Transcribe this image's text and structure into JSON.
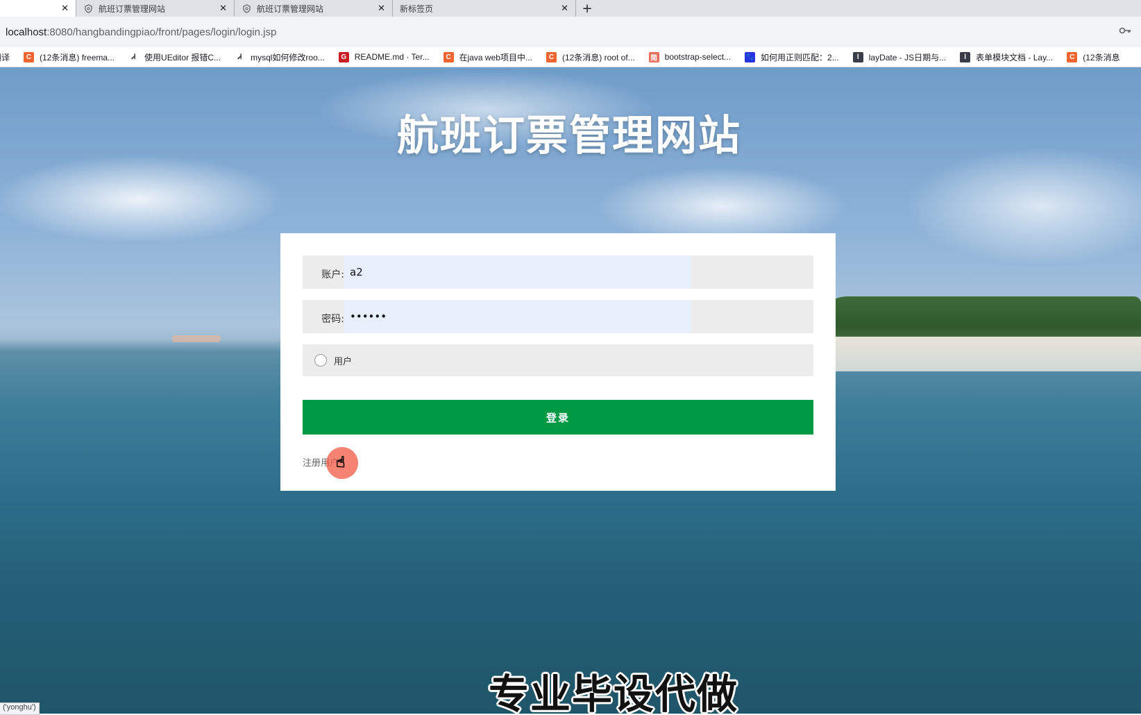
{
  "browser": {
    "tabs": [
      {
        "title": "",
        "active": true,
        "icon": "none"
      },
      {
        "title": "航班订票管理网站",
        "active": false,
        "icon": "shield-icon"
      },
      {
        "title": "航班订票管理网站",
        "active": false,
        "icon": "shield-icon"
      },
      {
        "title": "新标签页",
        "active": false,
        "icon": "none"
      }
    ],
    "close_glyph": "✕",
    "new_tab_glyph": "+",
    "url_host": "localhost",
    "url_rest": ":8080/hangbandingpiao/front/pages/login/login.jsp",
    "bookmarks": [
      {
        "label": "翻译",
        "color": "#ffffff",
        "glyph": ""
      },
      {
        "label": "(12条消息) freema...",
        "color": "#f0652f",
        "glyph": "C"
      },
      {
        "label": "使用UEditor 报错C...",
        "color": "#ffffff",
        "glyph": "Ꮧ"
      },
      {
        "label": "mysql如何修改roo...",
        "color": "#ffffff",
        "glyph": "Ꮧ"
      },
      {
        "label": "README.md · Ter...",
        "color": "#c71d23",
        "glyph": "G"
      },
      {
        "label": "在java web项目中...",
        "color": "#f0652f",
        "glyph": "C"
      },
      {
        "label": "(12条消息) root of...",
        "color": "#f0652f",
        "glyph": "C"
      },
      {
        "label": "bootstrap-select...",
        "color": "#ea6f5a",
        "glyph": "简"
      },
      {
        "label": "如何用正则匹配：2...",
        "color": "#2932e1",
        "glyph": "🐾"
      },
      {
        "label": "layDate - JS日期与...",
        "color": "#393d49",
        "glyph": "l"
      },
      {
        "label": "表单模块文档 - Lay...",
        "color": "#393d49",
        "glyph": "l"
      },
      {
        "label": "(12条消息",
        "color": "#f0652f",
        "glyph": "C"
      }
    ]
  },
  "page": {
    "site_title": "航班订票管理网站",
    "account_label": "账户:",
    "account_value": "a2",
    "password_label": "密码:",
    "password_value": "••••••",
    "role_option": "用户",
    "login_button": "登录",
    "register_link": "注册用户",
    "watermark": "专业毕设代做",
    "status_text": "('yonghu')"
  }
}
